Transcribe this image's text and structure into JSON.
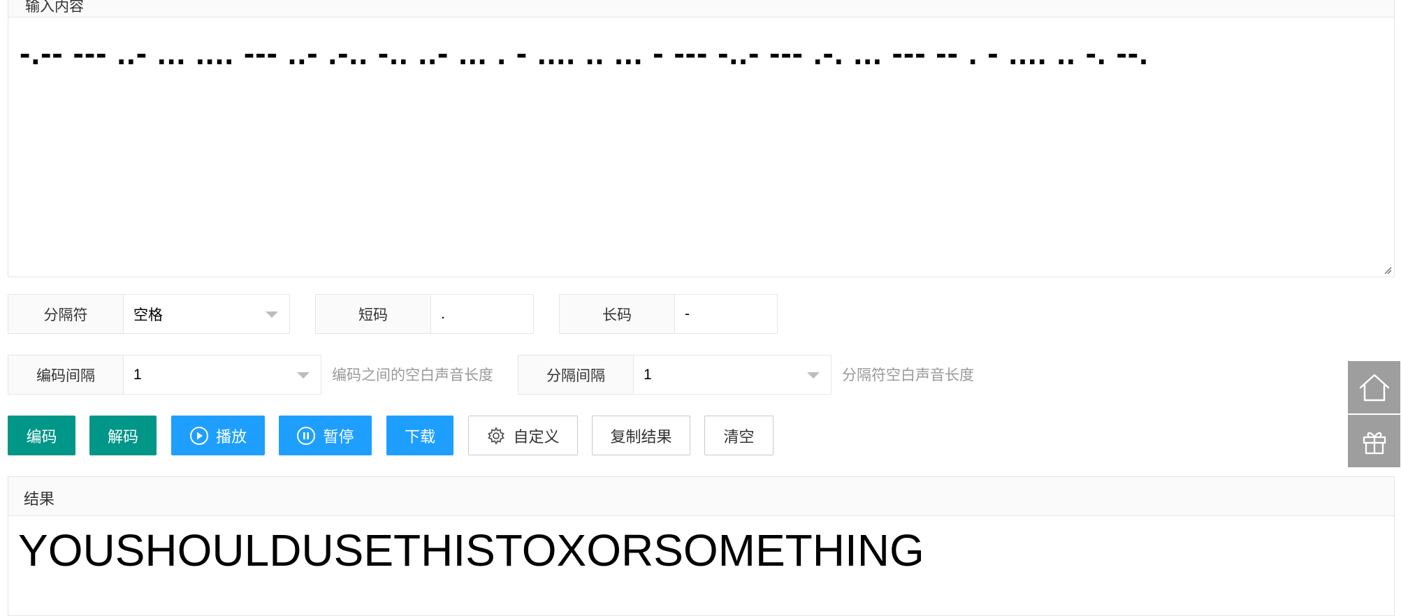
{
  "input": {
    "label": "输入内容",
    "value": "-.-- --- ..- ... .... --- ..- .-.. -.. ..- ... . - .... .. ... - --- -..- --- .-. ... --- -- . - .... .. -. --."
  },
  "options": {
    "separator": {
      "label": "分隔符",
      "value": "空格"
    },
    "short_code": {
      "label": "短码",
      "value": "."
    },
    "long_code": {
      "label": "长码",
      "value": "-"
    },
    "code_gap": {
      "label": "编码间隔",
      "value": "1",
      "hint": "编码之间的空白声音长度"
    },
    "sep_gap": {
      "label": "分隔间隔",
      "value": "1",
      "hint": "分隔符空白声音长度"
    }
  },
  "buttons": {
    "encode": "编码",
    "decode": "解码",
    "play": "播放",
    "pause": "暂停",
    "download": "下载",
    "custom": "自定义",
    "copy": "复制结果",
    "clear": "清空"
  },
  "result": {
    "label": "结果",
    "value": "YOUSHOULDUSETHISTOXORSOMETHING"
  },
  "side": {
    "home_icon": "home-icon",
    "gift_icon": "gift-icon"
  },
  "colors": {
    "teal": "#009688",
    "blue": "#1e9fff",
    "side": "#9e9e9e"
  }
}
